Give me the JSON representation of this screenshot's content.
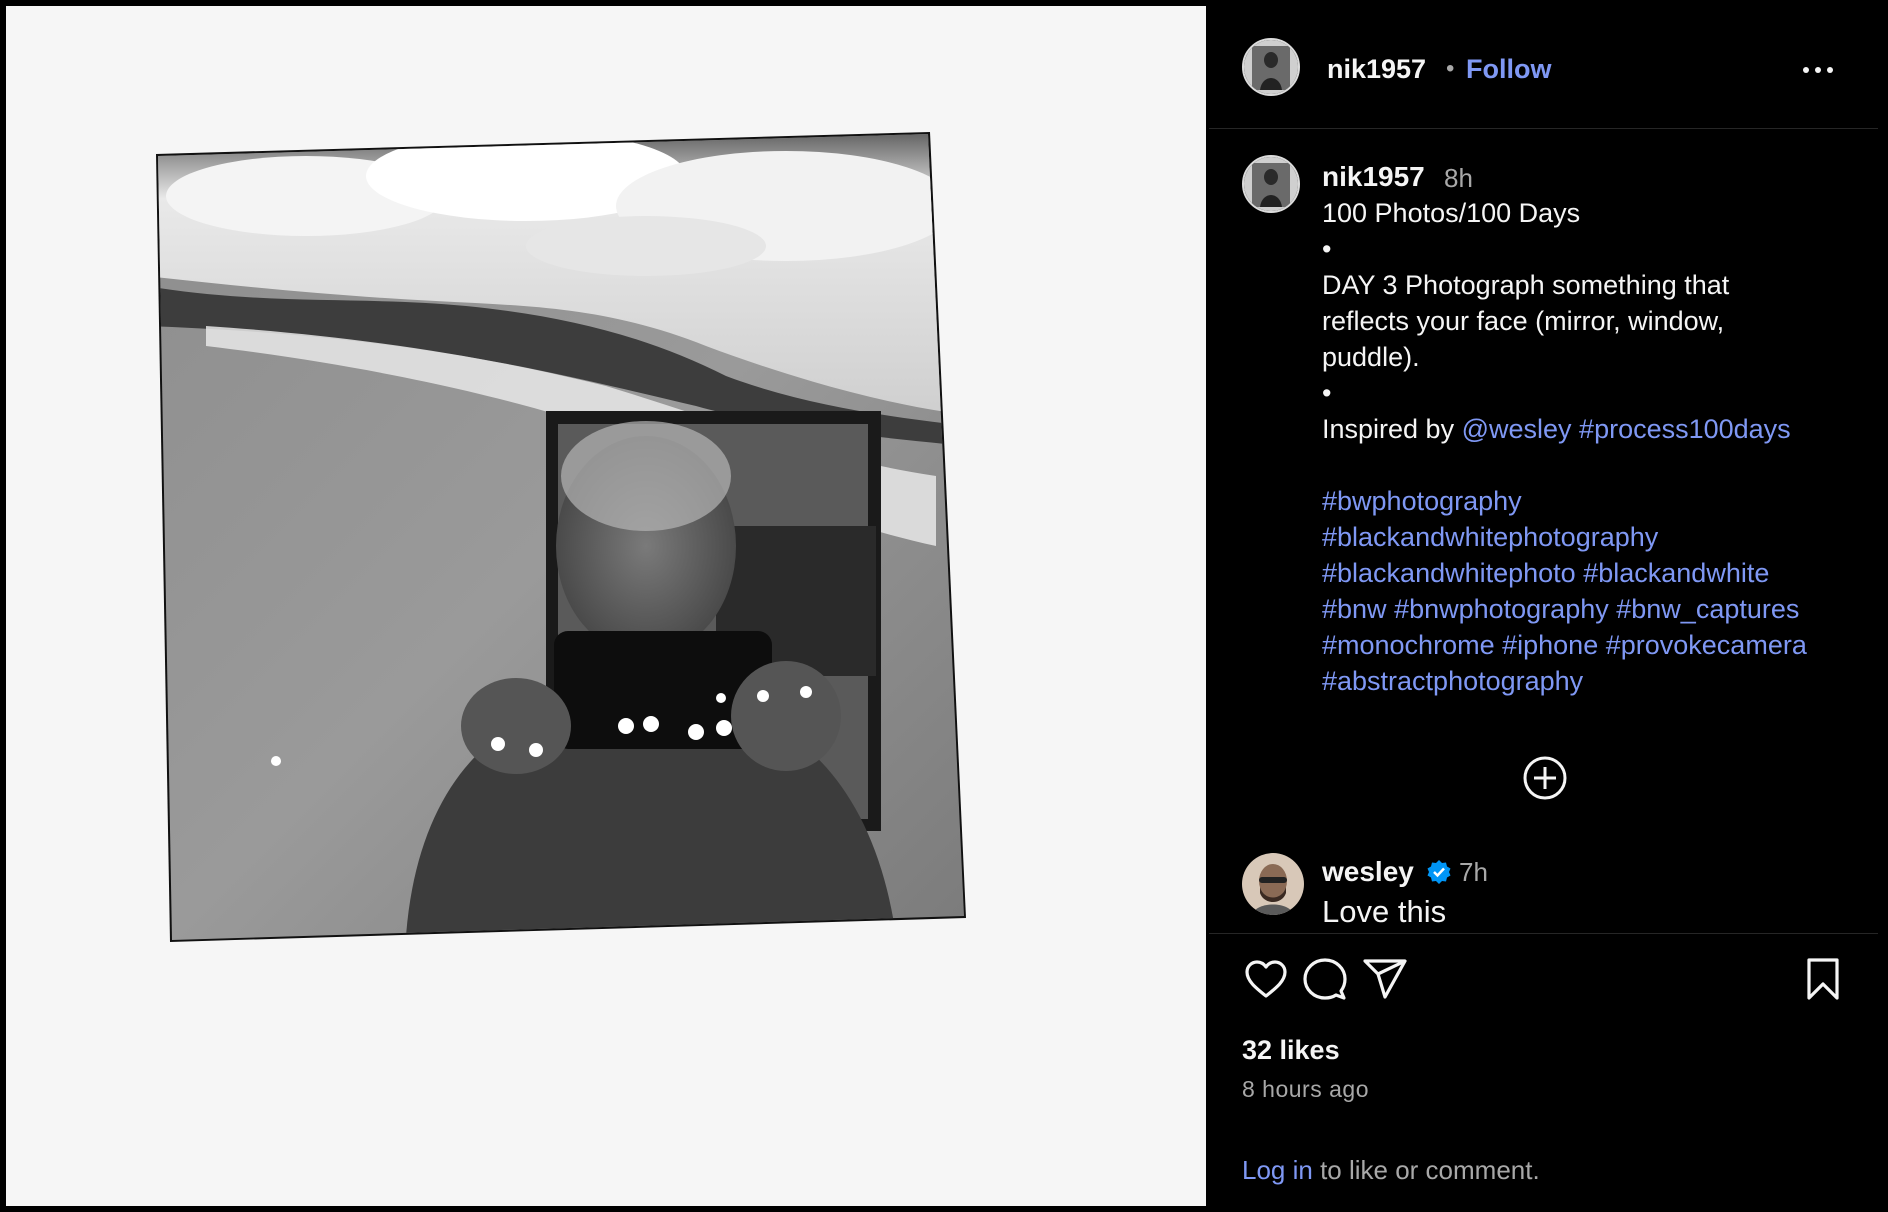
{
  "post": {
    "username": "nik1957",
    "separator": "•",
    "follow_label": "Follow",
    "more_icon": "more-horizontal-icon"
  },
  "caption": {
    "username": "nik1957",
    "time": "8h",
    "lines": {
      "l1": "100 Photos/100 Days",
      "l2": "•",
      "l3": "DAY 3 Photograph something that",
      "l4": "reflects your face (mirror, window,",
      "l5": "puddle).",
      "l6": "•",
      "inspired_prefix": "Inspired by ",
      "mention": "@wesley",
      "space": " ",
      "tag_process": "#process100days"
    },
    "hashtags": {
      "h1": "#bwphotography",
      "h2": "#blackandwhitephotography",
      "h3a": "#blackandwhitephoto",
      "h3b": "#blackandwhite",
      "h4a": "#bnw",
      "h4b": "#bnwphotography",
      "h4c": "#bnw_captures",
      "h5a": "#monochrome",
      "h5b": "#iphone",
      "h5c": "#provokecamera",
      "h6": "#abstractphotography"
    }
  },
  "comment": {
    "username": "wesley",
    "time": "7h",
    "text": "Love this"
  },
  "actions": {
    "likes": "32 likes",
    "time_ago": "8 hours ago",
    "login_link": "Log in",
    "login_suffix": " to like or comment."
  },
  "colors": {
    "link": "#7f98f4",
    "background": "#000000",
    "secondary_text": "#a8a8a8",
    "verified": "#0095f6"
  }
}
